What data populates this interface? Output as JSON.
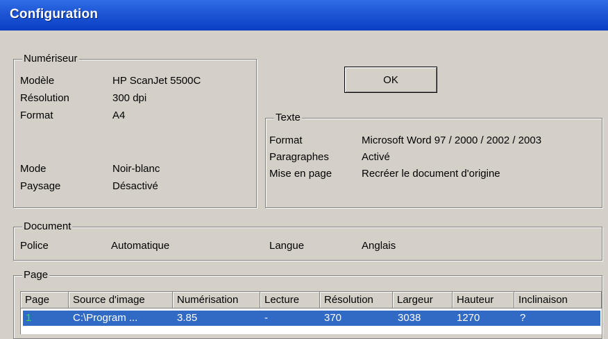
{
  "window": {
    "title": "Configuration"
  },
  "scanner": {
    "legend": "Numériseur",
    "rows": [
      {
        "label": "Modèle",
        "value": "HP ScanJet 5500C"
      },
      {
        "label": "Résolution",
        "value": "300 dpi"
      },
      {
        "label": "Format",
        "value": "A4"
      },
      {
        "label": "Mode",
        "value": "Noir-blanc"
      },
      {
        "label": "Paysage",
        "value": "Désactivé"
      }
    ]
  },
  "ok_button": {
    "label": "OK"
  },
  "text": {
    "legend": "Texte",
    "rows": [
      {
        "label": "Format",
        "value": "Microsoft Word 97 / 2000 / 2002 / 2003"
      },
      {
        "label": "Paragraphes",
        "value": "Activé"
      },
      {
        "label": "Mise en page",
        "value": "Recréer le document d'origine"
      }
    ]
  },
  "document": {
    "legend": "Document",
    "font_label": "Police",
    "font_value": "Automatique",
    "language_label": "Langue",
    "language_value": "Anglais"
  },
  "page": {
    "legend": "Page",
    "columns": [
      "Page",
      "Source d'image",
      "Numérisation",
      "Lecture",
      "Résolution",
      "Largeur",
      "Hauteur",
      "Inclinaison"
    ],
    "rows": [
      [
        "1",
        "C:\\Program ...",
        "3.85",
        "-",
        "370",
        "3038",
        "1270",
        "?"
      ]
    ]
  },
  "colors": {
    "title_bar": "#1f57d6",
    "selection": "#316ac5",
    "page_number": "#33e033"
  }
}
